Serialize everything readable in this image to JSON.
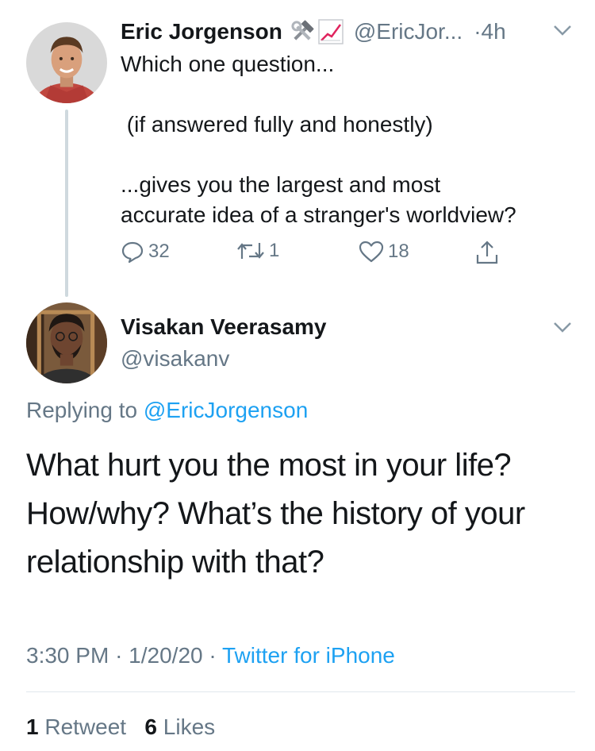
{
  "parent_tweet": {
    "author_name": "Eric Jorgenson",
    "emoji_icons": [
      "hammer-and-wrench-icon",
      "chart-increasing-icon"
    ],
    "handle": "@EricJor...",
    "separator": "·",
    "time": "4h",
    "text": "Which one question...\n\n (if answered fully and honestly)\n\n...gives you the largest and most\naccurate idea of a stranger's worldview?",
    "reply_count": "32",
    "retweet_count": "1",
    "like_count": "18"
  },
  "tweet": {
    "author_name": "Visakan Veerasamy",
    "handle": "@visakanv",
    "replying_prefix": "Replying to",
    "replying_to": "@EricJorgenson",
    "text": "What hurt you the most in your life? How/why? What’s the history of your relationship with that?",
    "time": "3:30 PM",
    "date": "1/20/20",
    "meta_separator": "·",
    "source": "Twitter for iPhone",
    "retweet_count": "1",
    "retweet_label": "Retweet",
    "like_count": "6",
    "like_label": "Likes"
  },
  "colors": {
    "link": "#1da1f2",
    "secondary_text": "#657786",
    "primary_text": "#14171a",
    "thread_line": "#cfd9de"
  }
}
